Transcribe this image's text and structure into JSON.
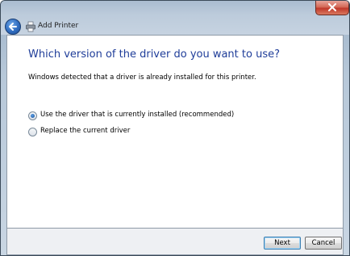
{
  "window": {
    "title": "Add Printer"
  },
  "page": {
    "heading": "Which version of the driver do you want to use?",
    "description": "Windows detected that a driver is already installed for this printer.",
    "options": [
      {
        "label": "Use the driver that is currently installed (recommended)",
        "selected": true
      },
      {
        "label": "Replace the current driver",
        "selected": false
      }
    ]
  },
  "buttons": {
    "next": "Next",
    "cancel": "Cancel"
  },
  "icons": {
    "back": "back-arrow-icon",
    "printer": "printer-icon",
    "close": "close-icon"
  },
  "colors": {
    "heading": "#1f3d99",
    "close_button": "#c0392b",
    "back_button": "#2f6cc0"
  }
}
